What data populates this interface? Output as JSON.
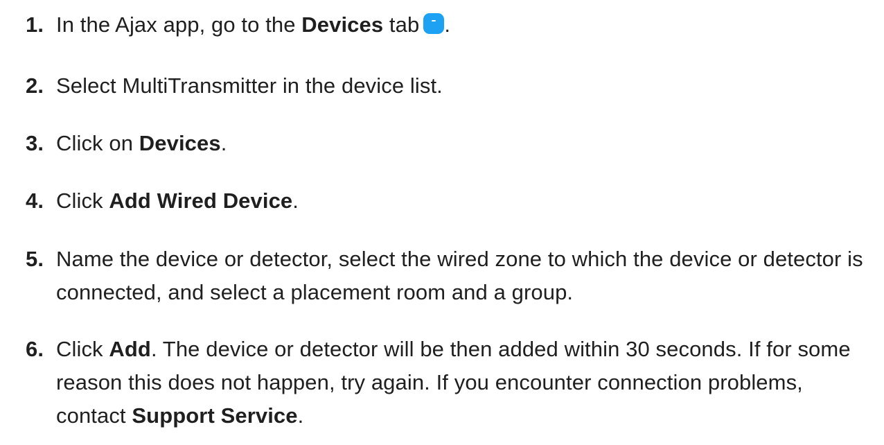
{
  "steps": [
    {
      "number": "1.",
      "part1": "In the Ajax app, go to the ",
      "bold1": "Devices",
      "part2": " tab",
      "icon": "devices-tab-icon",
      "part3": "."
    },
    {
      "number": "2.",
      "part1": "Select MultiTransmitter in the device list."
    },
    {
      "number": "3.",
      "part1": "Click on ",
      "bold1": "Devices",
      "part2": "."
    },
    {
      "number": "4.",
      "part1": "Click ",
      "bold1": "Add Wired Device",
      "part2": "."
    },
    {
      "number": "5.",
      "part1": "Name the device or detector, select the wired zone to which the device or detector is connected, and select a placement room and a group."
    },
    {
      "number": "6.",
      "part1": "Click ",
      "bold1": "Add",
      "part2": ". The device or detector will be then added within 30 seconds. If for some reason this does not happen, try again. If you encounter connection problems, contact ",
      "bold2": "Support Service",
      "part3": "."
    }
  ],
  "colors": {
    "text": "#1f1f1f",
    "accent": "#1da1f2"
  }
}
